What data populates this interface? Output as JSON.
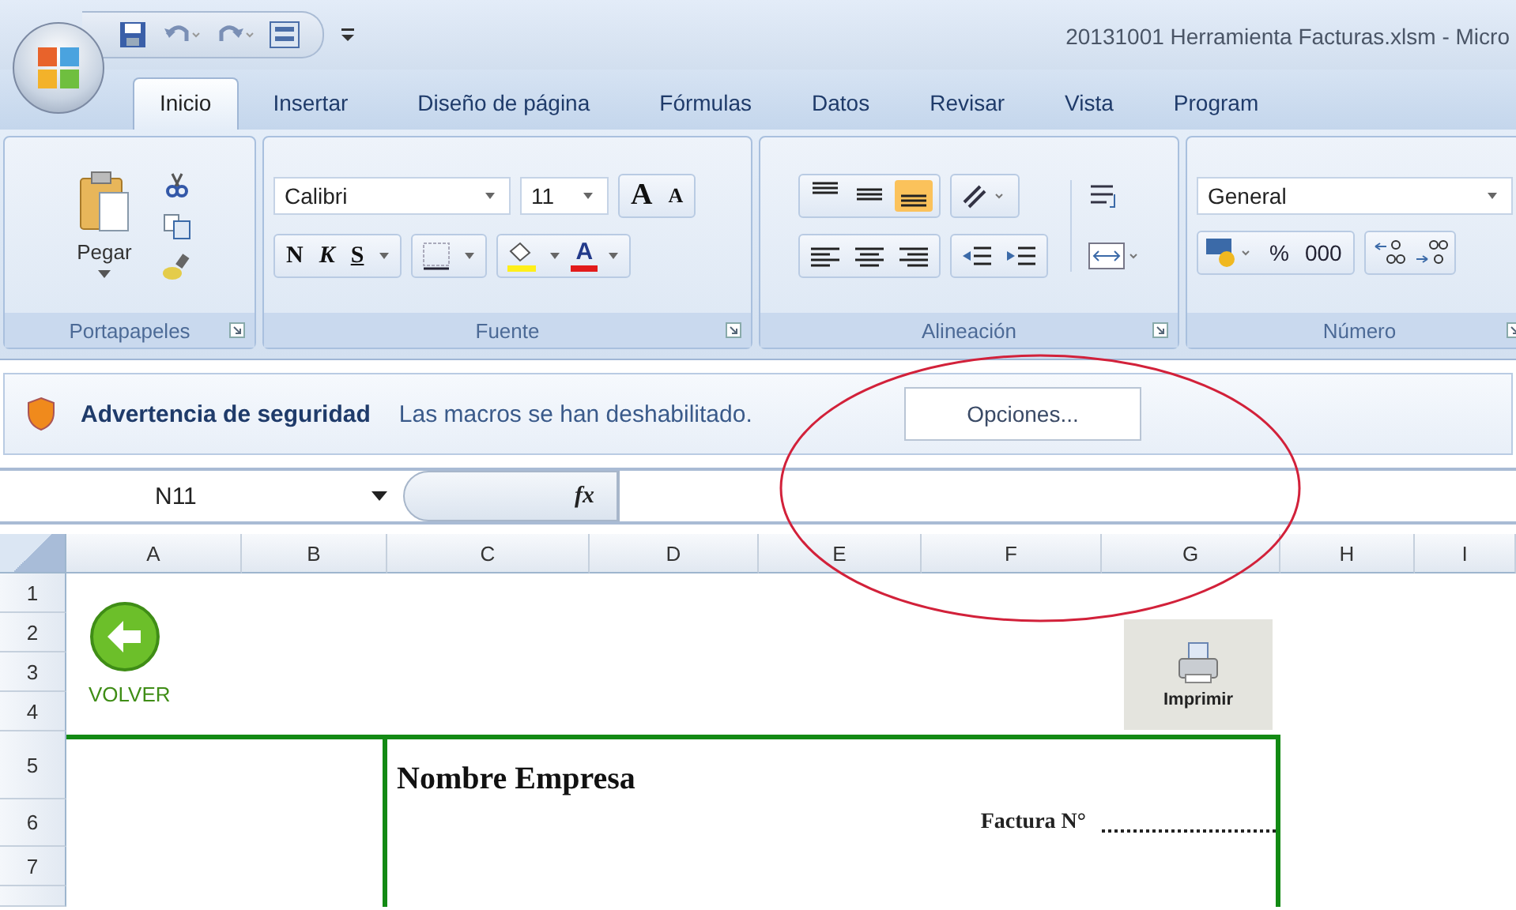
{
  "window": {
    "title": "20131001 Herramienta Facturas.xlsm - Micro"
  },
  "tabs": [
    {
      "label": "Inicio",
      "selected": true
    },
    {
      "label": "Insertar",
      "selected": false
    },
    {
      "label": "Diseño de página",
      "selected": false
    },
    {
      "label": "Fórmulas",
      "selected": false
    },
    {
      "label": "Datos",
      "selected": false
    },
    {
      "label": "Revisar",
      "selected": false
    },
    {
      "label": "Vista",
      "selected": false
    },
    {
      "label": "Program",
      "selected": false
    }
  ],
  "ribbon": {
    "groups": [
      {
        "kind": "clipboard",
        "label": "Portapapeles",
        "paste": "Pegar"
      },
      {
        "kind": "font",
        "label": "Fuente",
        "font_name": "Calibri",
        "font_size": "11",
        "grow": "A",
        "shrink": "A",
        "bold": "N",
        "italic": "K",
        "underline": "S",
        "font_color": "A"
      },
      {
        "kind": "alignment",
        "label": "Alineación"
      },
      {
        "kind": "number",
        "label": "Número",
        "format": "General",
        "percent": "%",
        "thousands": "000"
      }
    ]
  },
  "security_bar": {
    "title": "Advertencia de seguridad",
    "message": "Las macros se han deshabilitado.",
    "button": "Opciones..."
  },
  "formula_bar": {
    "name_box": "N11",
    "function_label": "fx"
  },
  "sheet": {
    "columns": [
      "A",
      "B",
      "C",
      "D",
      "E",
      "F",
      "G",
      "H",
      "I"
    ],
    "rows": [
      "1",
      "2",
      "3",
      "4",
      "5",
      "6",
      "7"
    ],
    "back_button": "VOLVER",
    "print_button": "Imprimir",
    "invoice": {
      "company": "Nombre Empresa",
      "number_label": "Factura N°"
    }
  }
}
